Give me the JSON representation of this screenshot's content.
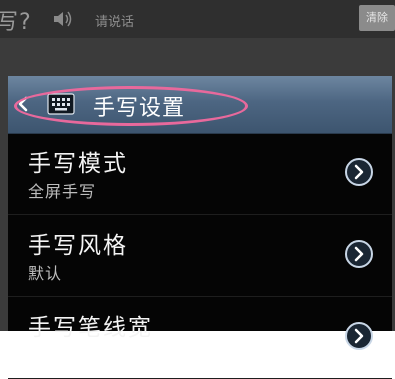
{
  "background": {
    "title": "写?",
    "hint": "请说话",
    "button_label": "清除"
  },
  "dialog": {
    "title": "手写设置",
    "items": [
      {
        "label": "手写模式",
        "value": "全屏手写"
      },
      {
        "label": "手写风格",
        "value": "默认"
      },
      {
        "label": "手写笔线宽",
        "value": ""
      }
    ]
  },
  "colors": {
    "header_blue": "#4d6682",
    "highlight_pink": "#e8699c",
    "dialog_bg": "#050505"
  },
  "icons": [
    "back-icon",
    "keyboard-icon",
    "chevron-right-icon",
    "speaker-icon"
  ]
}
